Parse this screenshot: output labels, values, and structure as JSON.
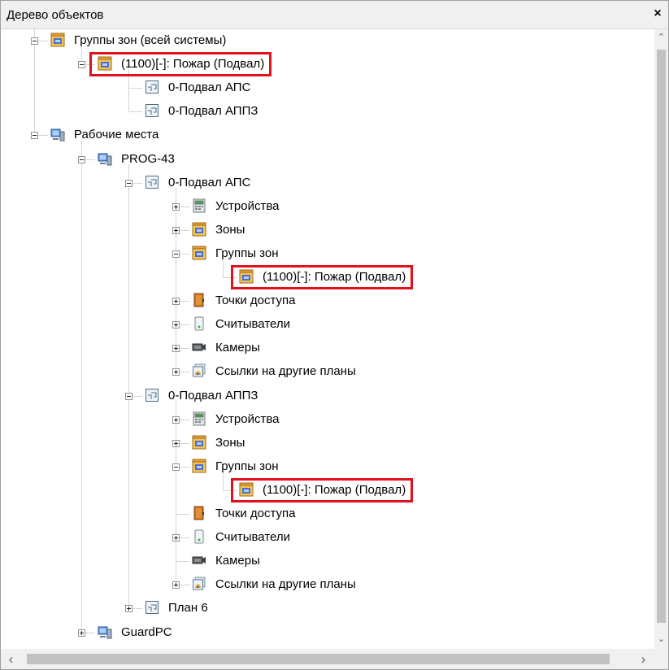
{
  "panel": {
    "title": "Дерево объектов",
    "close_glyph": "×"
  },
  "tree": [
    {
      "level": 0,
      "expander": "minus",
      "icon": "zone-group-icon",
      "label": "Группы зон (всей системы)"
    },
    {
      "level": 1,
      "expander": "minus",
      "icon": "zone-group-icon",
      "label": "(1100)[-]: Пожар (Подвал)",
      "highlighted": true
    },
    {
      "level": 2,
      "expander": "none",
      "icon": "plan-icon",
      "label": "0-Подвал АПС"
    },
    {
      "level": 2,
      "expander": "none",
      "icon": "plan-icon",
      "label": "0-Подвал АППЗ"
    },
    {
      "level": 0,
      "expander": "minus",
      "icon": "workstation-icon",
      "label": "Рабочие места"
    },
    {
      "level": 1,
      "expander": "minus",
      "icon": "workstation-icon",
      "label": "PROG-43"
    },
    {
      "level": 2,
      "expander": "minus",
      "icon": "plan-icon",
      "label": "0-Подвал АПС"
    },
    {
      "level": 3,
      "expander": "plus",
      "icon": "device-icon",
      "label": "Устройства"
    },
    {
      "level": 3,
      "expander": "plus",
      "icon": "zone-group-icon",
      "label": "Зоны"
    },
    {
      "level": 3,
      "expander": "minus",
      "icon": "zone-group-icon",
      "label": "Группы зон"
    },
    {
      "level": 4,
      "expander": "none",
      "icon": "zone-group-icon",
      "label": "(1100)[-]: Пожар (Подвал)",
      "highlighted": true
    },
    {
      "level": 3,
      "expander": "plus",
      "icon": "door-icon",
      "label": "Точки доступа"
    },
    {
      "level": 3,
      "expander": "plus",
      "icon": "reader-icon",
      "label": "Считыватели"
    },
    {
      "level": 3,
      "expander": "plus",
      "icon": "camera-icon",
      "label": "Камеры"
    },
    {
      "level": 3,
      "expander": "plus",
      "icon": "plan-link-icon",
      "label": "Ссылки на другие планы"
    },
    {
      "level": 2,
      "expander": "minus",
      "icon": "plan-icon",
      "label": "0-Подвал АППЗ"
    },
    {
      "level": 3,
      "expander": "plus",
      "icon": "device-icon",
      "label": "Устройства"
    },
    {
      "level": 3,
      "expander": "plus",
      "icon": "zone-group-icon",
      "label": "Зоны"
    },
    {
      "level": 3,
      "expander": "minus",
      "icon": "zone-group-icon",
      "label": "Группы зон"
    },
    {
      "level": 4,
      "expander": "none",
      "icon": "zone-group-icon",
      "label": "(1100)[-]: Пожар (Подвал)",
      "highlighted": true
    },
    {
      "level": 3,
      "expander": "none",
      "icon": "door-icon",
      "label": "Точки доступа"
    },
    {
      "level": 3,
      "expander": "plus",
      "icon": "reader-icon",
      "label": "Считыватели"
    },
    {
      "level": 3,
      "expander": "none",
      "icon": "camera-icon",
      "label": "Камеры"
    },
    {
      "level": 3,
      "expander": "plus",
      "icon": "plan-link-icon",
      "label": "Ссылки на другие планы"
    },
    {
      "level": 2,
      "expander": "plus",
      "icon": "plan-icon",
      "label": "План 6"
    },
    {
      "level": 1,
      "expander": "plus",
      "icon": "workstation-icon",
      "label": "GuardPC"
    }
  ],
  "scroll": {
    "up": "⌃",
    "down": "⌄",
    "left": "‹",
    "right": "›"
  },
  "colors": {
    "highlight": "#e1121d",
    "scrollbar": "#f0f0f0",
    "thumb": "#c2c2c2"
  }
}
